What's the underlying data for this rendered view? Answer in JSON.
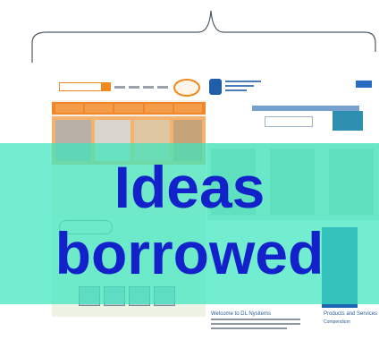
{
  "overlay": {
    "line1": "Ideas",
    "line2": "borrowed",
    "text_color": "#1221c9",
    "band_color": "#3ce6be"
  },
  "right_screenshot": {
    "welcome_heading": "Welcome to DL Nysitems",
    "products_heading": "Products and Services",
    "products_sub": "Compendium"
  },
  "colors": {
    "genica_orange": "#f0862a",
    "manatec_blue": "#1d63b3"
  }
}
